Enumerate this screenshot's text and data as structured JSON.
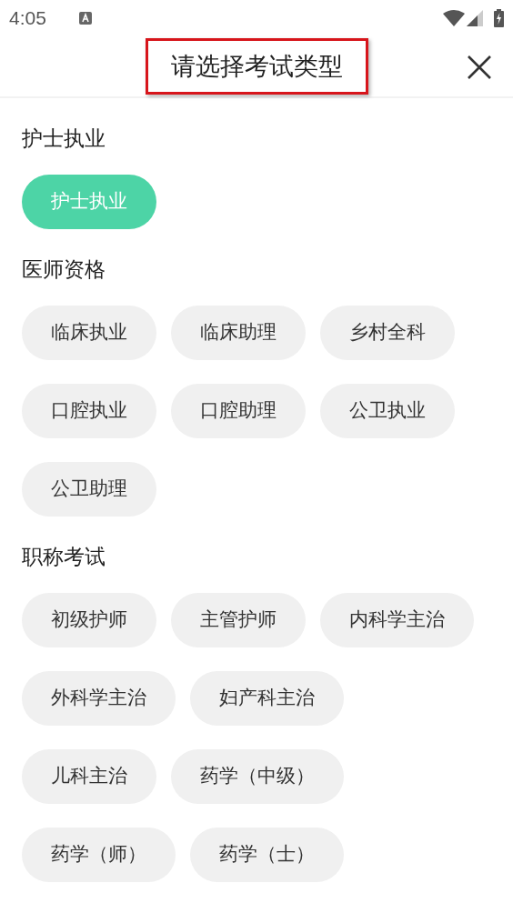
{
  "status_bar": {
    "time": "4:05"
  },
  "header": {
    "title": "请选择考试类型"
  },
  "sections": [
    {
      "title": "护士执业",
      "options": [
        {
          "label": "护士执业",
          "selected": true
        }
      ]
    },
    {
      "title": "医师资格",
      "options": [
        {
          "label": "临床执业",
          "selected": false
        },
        {
          "label": "临床助理",
          "selected": false
        },
        {
          "label": "乡村全科",
          "selected": false
        },
        {
          "label": "口腔执业",
          "selected": false
        },
        {
          "label": "口腔助理",
          "selected": false
        },
        {
          "label": "公卫执业",
          "selected": false
        },
        {
          "label": "公卫助理",
          "selected": false
        }
      ]
    },
    {
      "title": "职称考试",
      "options": [
        {
          "label": "初级护师",
          "selected": false
        },
        {
          "label": "主管护师",
          "selected": false
        },
        {
          "label": "内科学主治",
          "selected": false
        },
        {
          "label": "外科学主治",
          "selected": false
        },
        {
          "label": "妇产科主治",
          "selected": false
        },
        {
          "label": "儿科主治",
          "selected": false
        },
        {
          "label": "药学（中级）",
          "selected": false
        },
        {
          "label": "药学（师）",
          "selected": false
        },
        {
          "label": "药学（士）",
          "selected": false
        }
      ]
    }
  ]
}
